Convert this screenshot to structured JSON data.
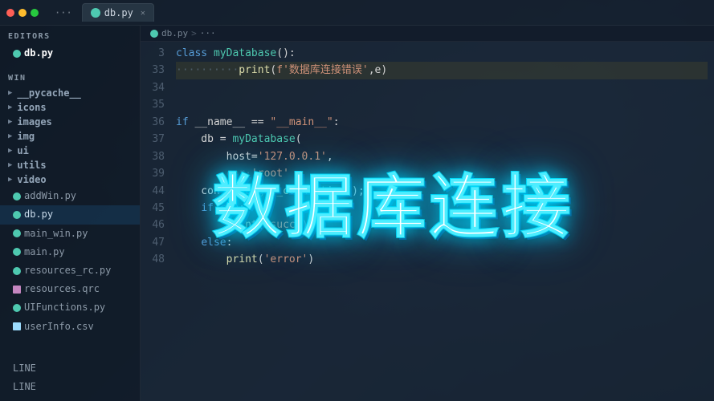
{
  "titlebar": {
    "ellipsis_label": "···",
    "active_tab_name": "db.py",
    "close_label": "✕",
    "breadcrumb_file": "db.py",
    "breadcrumb_sep": ">",
    "breadcrumb_dots": "···"
  },
  "sidebar": {
    "editors_label": "EDITORS",
    "active_editor": "db.py",
    "win_label": "WIN",
    "folders": [
      "__pycache__",
      "icons",
      "images",
      "img",
      "ui",
      "utils",
      "video"
    ],
    "files": [
      "addWin.py",
      "db.py",
      "main_win.py",
      "main.py",
      "resources_rc.py",
      "resources.qrc",
      "UIFunctions.py",
      "userInfo.csv"
    ],
    "bottom_items": [
      "LINE",
      "LINE"
    ]
  },
  "code": {
    "lines": [
      {
        "num": "3",
        "content": "class myDatabase():"
      },
      {
        "num": "33",
        "content": "··········print(f'数据库连接错误',e)",
        "highlighted": true
      },
      {
        "num": "34",
        "content": ""
      },
      {
        "num": "35",
        "content": ""
      },
      {
        "num": "36",
        "content": "if __name__ == \"__main__\":"
      },
      {
        "num": "37",
        "content": "    db = myDatabase("
      },
      {
        "num": "38",
        "content": "        host='127.0.0.1',"
      },
      {
        "num": "39",
        "content": "        cor·'root'"
      },
      {
        "num": "44",
        "content": "    con = db.get_connection();"
      },
      {
        "num": "45",
        "content": "    if con:"
      },
      {
        "num": "46",
        "content": "        print('succ')"
      },
      {
        "num": "47",
        "content": "    else:"
      },
      {
        "num": "48",
        "content": "        print('error')"
      }
    ]
  },
  "overlay": {
    "big_title": "数据库连接"
  },
  "status": {
    "item1": "LINE",
    "item2": "LINE"
  }
}
